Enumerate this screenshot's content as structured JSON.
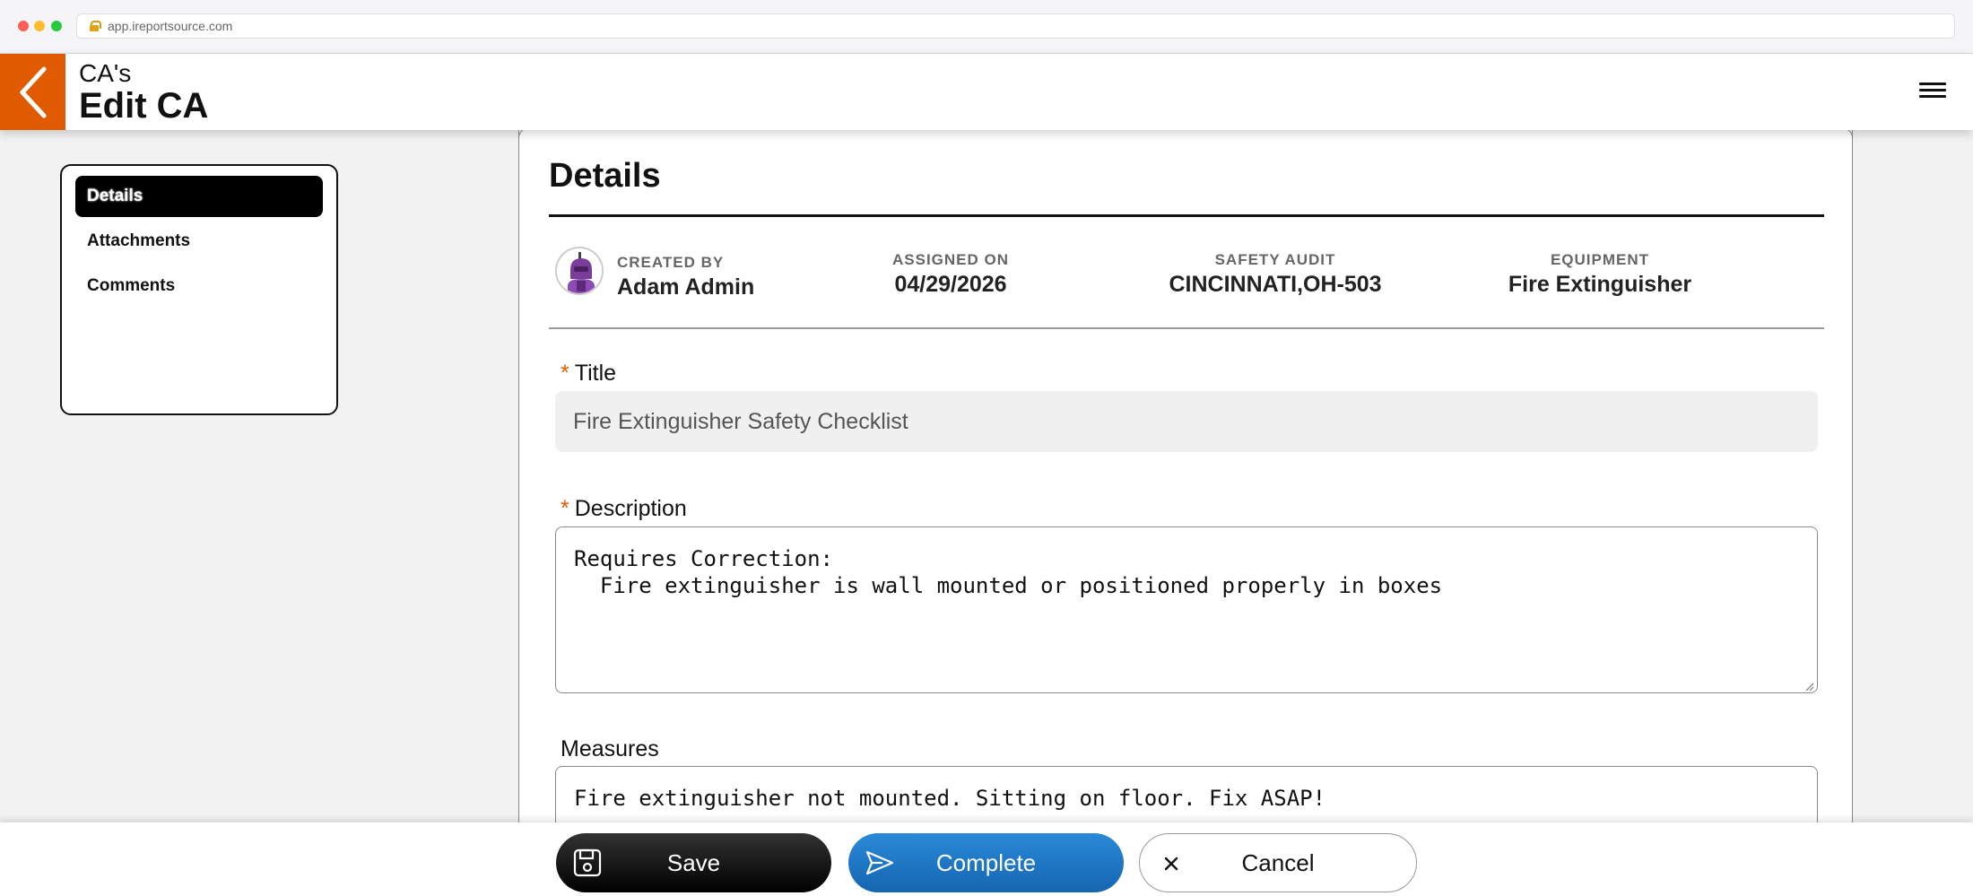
{
  "browser": {
    "url": "app.ireportsource.com"
  },
  "header": {
    "subtitle": "CA's",
    "title": "Edit CA"
  },
  "sidebar": {
    "items": [
      {
        "label": "Details"
      },
      {
        "label": "Attachments"
      },
      {
        "label": "Comments"
      }
    ],
    "active": "Details"
  },
  "details": {
    "title": "Details",
    "meta": {
      "created_by": {
        "label": "CREATED BY",
        "value": "Adam Admin"
      },
      "assigned_on": {
        "label": "ASSIGNED ON",
        "value": "04/29/2026"
      },
      "safety_audit": {
        "label": "SAFETY AUDIT",
        "value": "CINCINNATI,OH-503"
      },
      "equipment": {
        "label": "EQUIPMENT",
        "value": "Fire Extinguisher"
      }
    },
    "fields": {
      "title": {
        "label": "Title",
        "required": "*",
        "value": "Fire Extinguisher Safety Checklist"
      },
      "description": {
        "label": "Description",
        "required": "*",
        "value": "Requires Correction:\n  Fire extinguisher is wall mounted or positioned properly in boxes"
      },
      "measures": {
        "label": "Measures",
        "value": "Fire extinguisher not mounted. Sitting on floor. Fix ASAP!"
      }
    }
  },
  "actions": {
    "save": "Save",
    "complete": "Complete",
    "cancel": "Cancel"
  },
  "colors": {
    "accent": "#e05a00",
    "complete": "#1a74c4",
    "save": "#000000"
  }
}
